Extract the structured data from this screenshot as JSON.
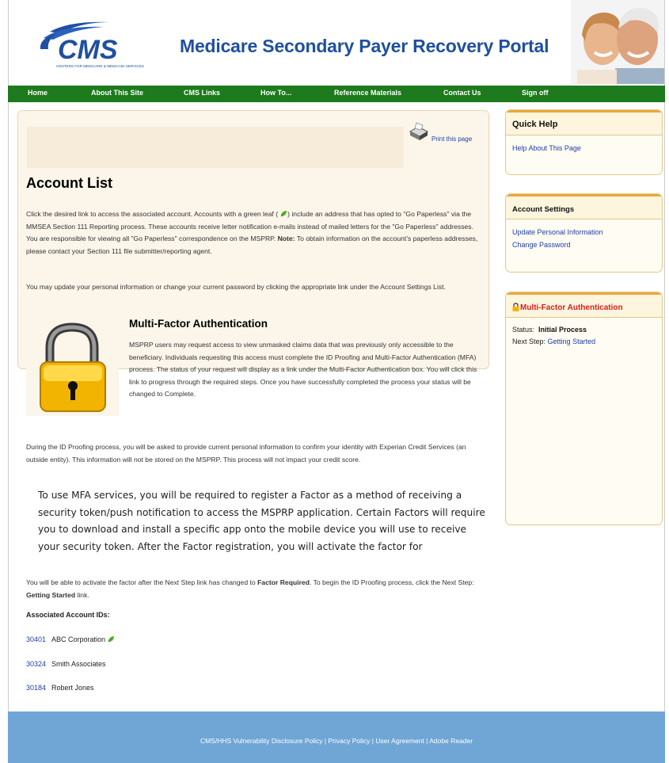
{
  "header": {
    "logo_text": "CMS",
    "logo_subtext": "CENTERS FOR MEDICARE & MEDICAID SERVICES",
    "portal_title": "Medicare Secondary Payer Recovery Portal"
  },
  "nav": {
    "items": [
      {
        "label": "Home"
      },
      {
        "label": "About This Site"
      },
      {
        "label": "CMS Links"
      },
      {
        "label": "How To..."
      },
      {
        "label": "Reference Materials"
      },
      {
        "label": "Contact Us"
      },
      {
        "label": "Sign off"
      }
    ]
  },
  "main": {
    "print_link": "Print this page",
    "page_title": "Account List",
    "intro": {
      "part1": "Click the desired link to access the associated account. Accounts with a green leaf (",
      "part2": ") include an address that has opted to \"Go Paperless\" via the MMSEA Section 111 Reporting process. These accounts receive letter notification e-mails instead of mailed letters for the \"Go Paperless\" addresses. You are responsible for viewing all \"Go Paperless\" correspondence on the MSPRP. ",
      "note_label": "Note:",
      "part3": " To obtain information on the account's paperless addresses, please contact your Section 111 file submitter/reporting agent."
    },
    "settings_para": "You may update your personal information or change your current password by clicking the appropriate link under the Account Settings List.",
    "mfa_heading": "Multi-Factor Authentication",
    "mfa_para": "MSPRP users may request access to view unmasked claims data that was previously only accessible to the beneficiary. Individuals requesting this access must complete the ID Proofing and Multi-Factor Authentication (MFA) process. The status of your request will display as a link under the Multi-Factor Authentication box. You will click this link to progress through the required steps. Once you have successfully completed the process your status will be changed to Complete.",
    "proofing_para": "During the ID Proofing process, you will be asked to provide current personal information to confirm your identity with Experian Credit Services (an outside entity). This information will not be stored on the MSPRP. This process will not impact your credit score.",
    "large_para": "To use MFA services, you will be required to register a Factor as a method of receiving a security token/push notification to access the MSPRP application. Certain Factors will require you to download and install a specific app onto the mobile device you will use to receive your security token. After the Factor registration, you will activate the factor for",
    "activate": {
      "part1": "You will be able to activate the factor after the Next Step link has changed to ",
      "bold1": "Factor Required",
      "part2": ". To begin the ID Proofing process, click the Next Step: ",
      "bold2": "Getting Started",
      "part3": " link."
    },
    "accounts_label": "Associated Account IDs:",
    "accounts": [
      {
        "id": "30401",
        "name": "ABC Corporation",
        "paperless": true
      },
      {
        "id": "30324",
        "name": "Smith Associates",
        "paperless": false
      },
      {
        "id": "30184",
        "name": "Robert Jones",
        "paperless": false
      }
    ]
  },
  "sidebar": {
    "quick_help": {
      "title": "Quick Help",
      "link": "Help About This Page"
    },
    "account_settings": {
      "title": "Account Settings",
      "links": [
        "Update Personal Information",
        "Change Password"
      ]
    },
    "mfa": {
      "title": "Multi-Factor Authentication",
      "status_label": "Status:",
      "status_value": "Initial Process",
      "next_step_label": "Next Step:",
      "next_step_link": "Getting Started"
    }
  },
  "footer": {
    "links": [
      "CMS/HHS Vulnerability Disclosure Policy",
      "Privacy Policy",
      "User Agreement",
      "Adobe Reader"
    ],
    "separator": " | "
  },
  "colors": {
    "nav_green": "#1d7a1d",
    "title_blue": "#1f4fa0",
    "link_blue": "#1f3fa3",
    "footer_blue": "#6fa6d6",
    "mfa_red": "#d42020",
    "panel_beige": "#fbf5ea",
    "box_orange": "#e8a93a"
  },
  "icons": {
    "print": "printer-icon",
    "leaf": "green-leaf-icon",
    "lock": "padlock-icon"
  }
}
